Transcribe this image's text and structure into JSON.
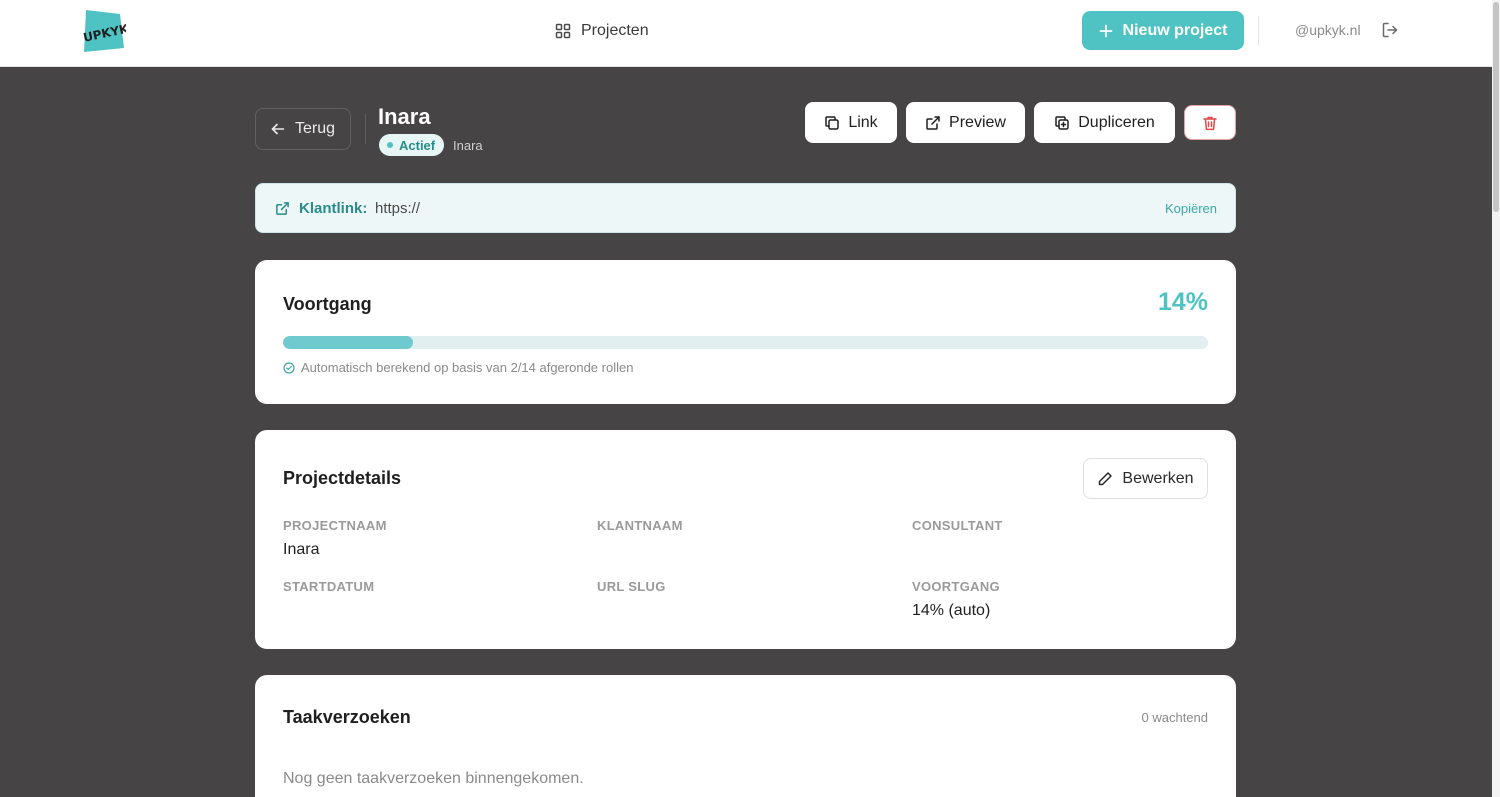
{
  "nav": {
    "logo_text": "UPKYK",
    "projects_label": "Projecten",
    "new_project_label": "Nieuw project",
    "user_email": "@upkyk.nl"
  },
  "header": {
    "back_label": "Terug",
    "project_title": "Inara",
    "status_label": "Actief",
    "client_name": "Inara",
    "actions": {
      "link_label": "Link",
      "preview_label": "Preview",
      "duplicate_label": "Dupliceren"
    }
  },
  "client_link": {
    "label": "Klantlink:",
    "url": "https://",
    "copy_label": "Kopiëren"
  },
  "progress": {
    "title": "Voortgang",
    "percent_label": "14%",
    "value": 0.14,
    "note": "Automatisch berekend op basis van 2/14 afgeronde rollen"
  },
  "details": {
    "title": "Projectdetails",
    "edit_label": "Bewerken",
    "fields": {
      "project_name": {
        "label": "PROJECTNAAM",
        "value": "Inara"
      },
      "client_name": {
        "label": "KLANTNAAM",
        "value": ""
      },
      "consultant": {
        "label": "CONSULTANT",
        "value": ""
      },
      "start_date": {
        "label": "STARTDATUM",
        "value": ""
      },
      "url_slug": {
        "label": "URL SLUG",
        "value": ""
      },
      "progress": {
        "label": "VOORTGANG",
        "value": "14% (auto)"
      }
    }
  },
  "tasks": {
    "title": "Taakverzoeken",
    "count_label": "0 wachtend",
    "empty_text": "Nog geen taakverzoeken binnengekomen."
  },
  "colors": {
    "accent": "#4fc3c3",
    "background": "#464444",
    "danger": "#e04848"
  }
}
